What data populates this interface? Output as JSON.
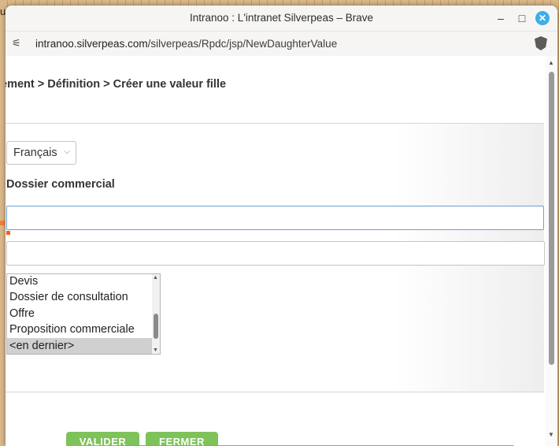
{
  "window": {
    "title": "Intranoo : L'intranet Silverpeas – Brave",
    "minimize": "–",
    "maximize": "□",
    "close": "✕"
  },
  "address_bar": {
    "host": "intranoo.silverpeas.com",
    "path": "/silverpeas/Rpdc/jsp/NewDaughterValue"
  },
  "page": {
    "breadcrumb": "ement > Définition > Créer une valeur fille",
    "language_select": "Français",
    "section_title": "Dossier commercial",
    "name_input_value": "",
    "description_value": "",
    "position_list": {
      "options": [
        "Devis",
        "Dossier de consultation",
        "Offre",
        "Proposition commerciale",
        "<en dernier>"
      ],
      "selected": "<en dernier>"
    },
    "buttons": {
      "validate": "VALIDER",
      "close": "FERMER"
    }
  },
  "backdrop": {
    "edge_char": "u"
  },
  "colors": {
    "accent_button": "#7ec25a",
    "focus_border": "#6b9fd3",
    "required_mark": "#ff5a1f",
    "close_button": "#3daee9"
  }
}
